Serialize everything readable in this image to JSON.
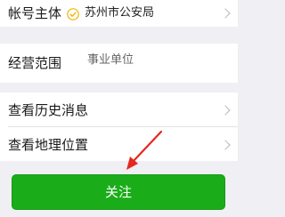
{
  "rows": {
    "account_subject": {
      "label": "帐号主体",
      "value": "苏州市公安局",
      "icon": "verified-check-icon"
    },
    "business_scope": {
      "label": "经营范围",
      "value": "事业单位"
    },
    "history_messages": {
      "label": "查看历史消息"
    },
    "location": {
      "label": "查看地理位置"
    }
  },
  "follow_button": {
    "label": "关注"
  },
  "colors": {
    "background": "#efeff4",
    "button_green": "#1aad19",
    "verified_yellow": "#f0b400",
    "arrow_red": "#e6281e"
  }
}
